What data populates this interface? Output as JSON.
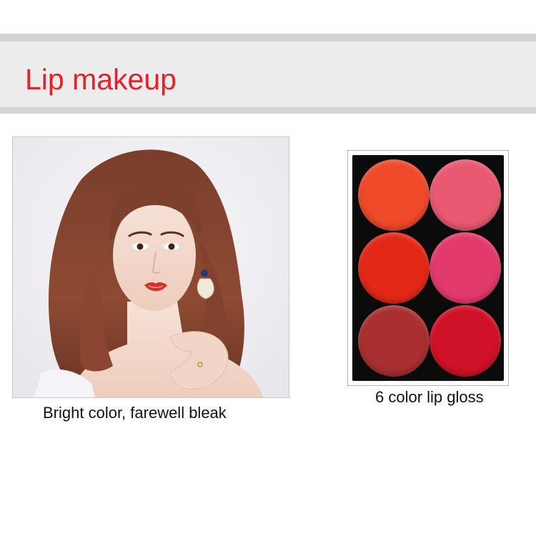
{
  "header": {
    "title": "Lip makeup",
    "title_color": "#e8202a"
  },
  "model_photo": {
    "caption": "Bright color, farewell bleak"
  },
  "palette": {
    "caption": "6 color lip gloss",
    "case_color": "#0b0b0b",
    "shades": [
      {
        "color": "#ef4a2a"
      },
      {
        "color": "#e95a72"
      },
      {
        "color": "#e42818"
      },
      {
        "color": "#e33a6c"
      },
      {
        "color": "#a92f31"
      },
      {
        "color": "#cf1228"
      }
    ]
  }
}
